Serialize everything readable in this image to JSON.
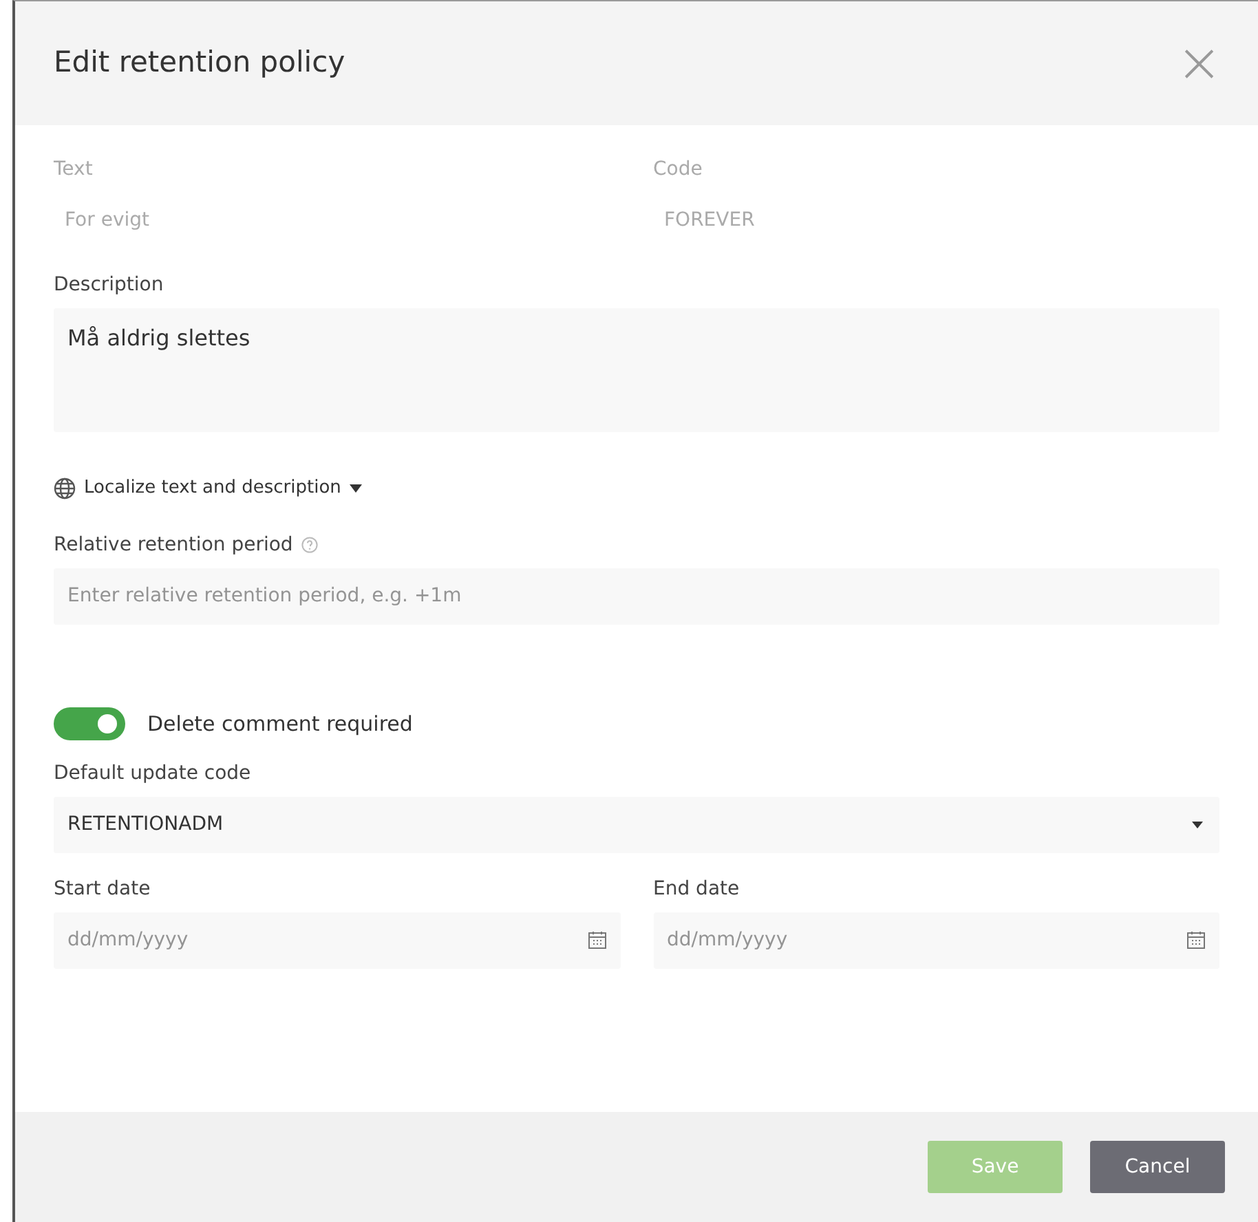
{
  "dialog": {
    "title": "Edit retention policy",
    "close": "×"
  },
  "text_field": {
    "label": "Text",
    "value": "For evigt",
    "disabled": true
  },
  "code_field": {
    "label": "Code",
    "value": "FOREVER",
    "disabled": true
  },
  "description": {
    "label": "Description",
    "value": "Må aldrig slettes"
  },
  "localize_link": {
    "label": "Localize text and description",
    "expanded": false
  },
  "relative_period": {
    "label": "Relative retention period",
    "placeholder": "Enter relative retention period, e.g. +1m"
  },
  "delete_comment": {
    "label": "Delete comment required",
    "on": true
  },
  "update_code": {
    "label": "Default update code",
    "value": "RETENTIONADM"
  },
  "start_date": {
    "label": "Start date",
    "placeholder": "dd/mm/yyyy"
  },
  "end_date": {
    "label": "End date",
    "placeholder": "dd/mm/yyyy"
  },
  "buttons": [
    {
      "label": "Save",
      "kind": "primary",
      "disabled": true
    },
    {
      "label": "Cancel",
      "kind": "secondary",
      "disabled": false
    }
  ]
}
